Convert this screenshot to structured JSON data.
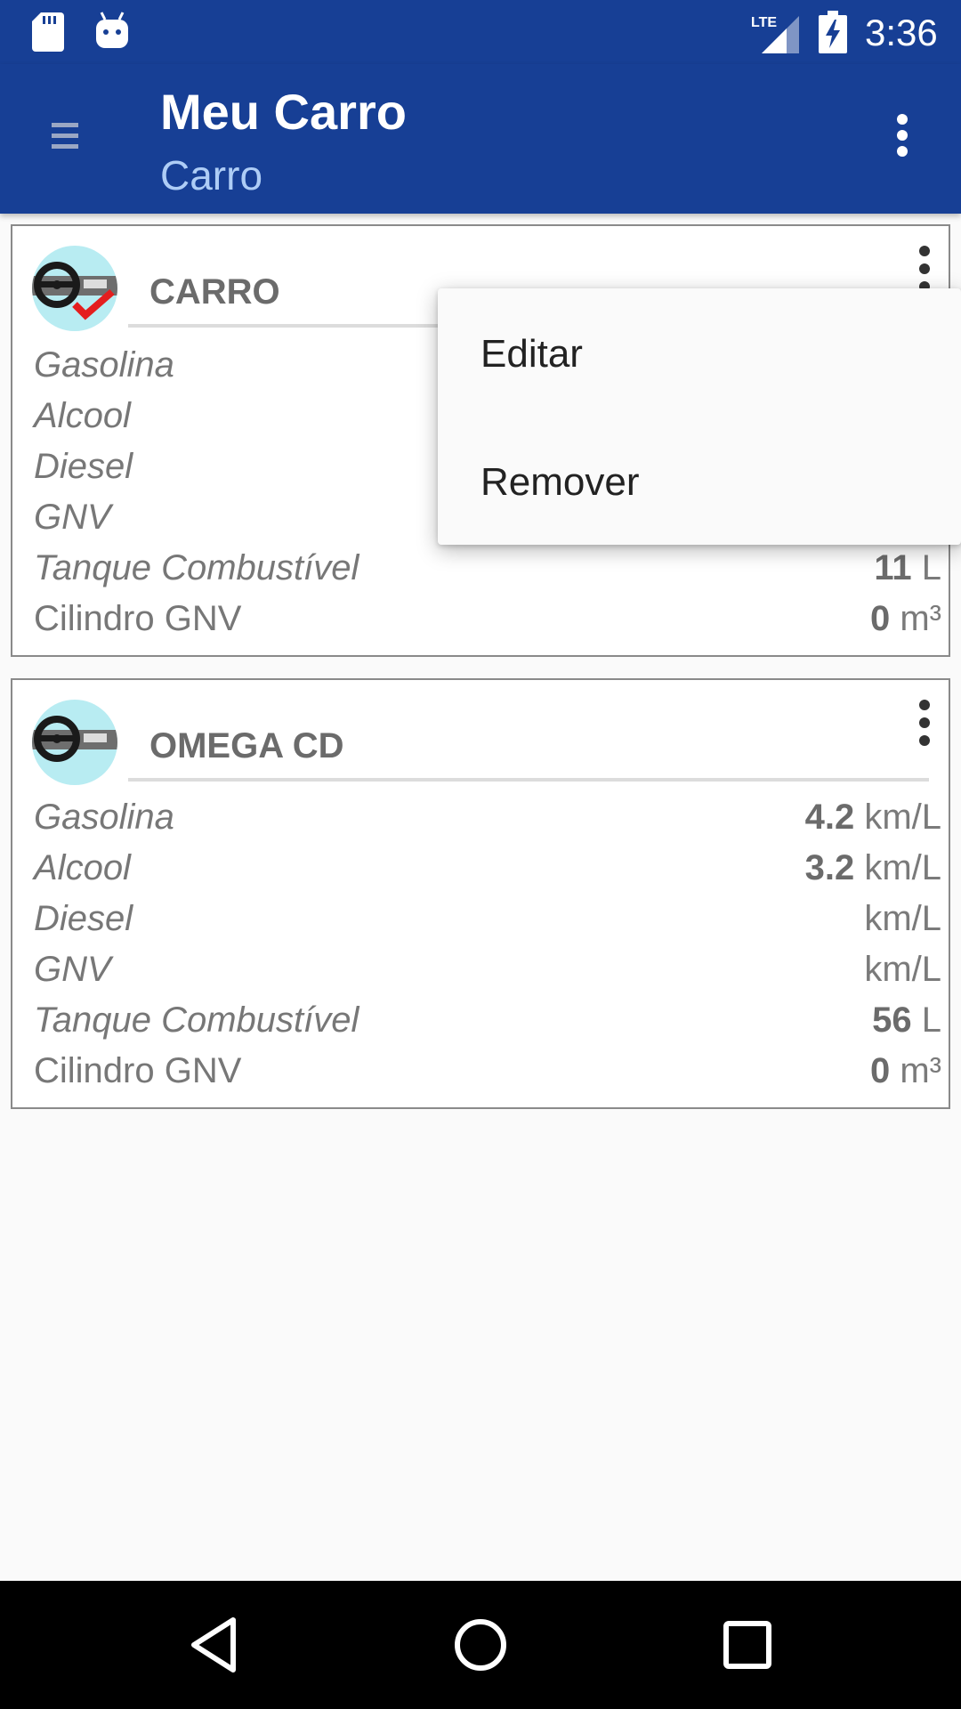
{
  "status_bar": {
    "time": "3:36",
    "network": "LTE",
    "icons": [
      "sd-card-icon",
      "android-icon",
      "signal-icon",
      "battery-charging-icon"
    ]
  },
  "app_bar": {
    "title": "Meu Carro",
    "subtitle": "Carro",
    "icons": [
      "menu-icon",
      "overflow-icon"
    ]
  },
  "cars": [
    {
      "name": "CARRO",
      "selected": true,
      "rows": [
        {
          "label": "Gasolina",
          "value": "",
          "unit": ""
        },
        {
          "label": "Alcool",
          "value": "",
          "unit": ""
        },
        {
          "label": "Diesel",
          "value": "",
          "unit": ""
        },
        {
          "label": "GNV",
          "value": "",
          "unit": ""
        },
        {
          "label": "Tanque Combustível",
          "value": "11",
          "unit": "L"
        },
        {
          "label": "Cilindro GNV",
          "value": "0",
          "unit": "m³"
        }
      ]
    },
    {
      "name": "OMEGA CD",
      "selected": false,
      "rows": [
        {
          "label": "Gasolina",
          "value": "4.2",
          "unit": "km/L"
        },
        {
          "label": "Alcool",
          "value": "3.2",
          "unit": "km/L"
        },
        {
          "label": "Diesel",
          "value": "",
          "unit": "km/L"
        },
        {
          "label": "GNV",
          "value": "",
          "unit": "km/L"
        },
        {
          "label": "Tanque Combustível",
          "value": "56",
          "unit": "L"
        },
        {
          "label": "Cilindro GNV",
          "value": "0",
          "unit": "m³"
        }
      ]
    }
  ],
  "popup_menu": {
    "items": [
      "Editar",
      "Remover"
    ]
  },
  "colors": {
    "primary": "#173f95",
    "subtitle": "#aecdf6",
    "avatar_bg": "#b8ecf2",
    "check": "#e41e1e"
  }
}
